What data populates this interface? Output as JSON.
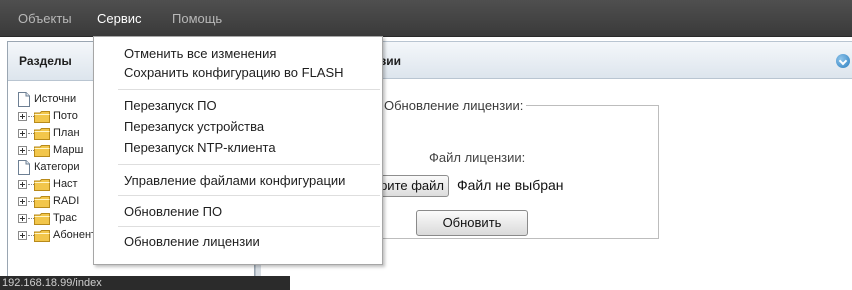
{
  "menubar": {
    "items": [
      "Объекты",
      "Сервис",
      "Помощь"
    ],
    "active": "Сервис"
  },
  "left_panel": {
    "title": "Разделы",
    "tree": [
      {
        "label": "Источни",
        "kind": "doc",
        "expander": false
      },
      {
        "label": "Пото",
        "kind": "folder",
        "expander": true
      },
      {
        "label": "План",
        "kind": "folder",
        "expander": true
      },
      {
        "label": "Марш",
        "kind": "folder",
        "expander": true
      },
      {
        "label": "Категори",
        "kind": "doc",
        "expander": false
      },
      {
        "label": "Наст",
        "kind": "folder",
        "expander": true
      },
      {
        "label": "RADI",
        "kind": "folder",
        "expander": true
      },
      {
        "label": "Трас",
        "kind": "folder",
        "expander": true
      },
      {
        "label": "Абоненты",
        "kind": "folder",
        "expander": true
      }
    ]
  },
  "right_panel": {
    "title": "нзии",
    "license_form": {
      "legend": "Обновление лицензии:",
      "file_label": "Файл лицензии:",
      "choose_button": "рите файл",
      "no_file_text": "Файл не выбран",
      "update_button": "Обновить"
    }
  },
  "dropdown": {
    "items": [
      "Отменить все изменения",
      "Сохранить конфигурацию во FLASH",
      "Перезапуск ПО",
      "Перезапуск устройства",
      "Перезапуск NTP-клиента",
      "Управление файлами конфигурации",
      "Обновление ПО",
      "Обновление лицензии"
    ]
  },
  "status_url": "192.168.18.99/index",
  "colors": {
    "menubar_bg": "#3f3f3f",
    "accent_blue": "#2b7fc0",
    "folder": "#f2c64b"
  }
}
